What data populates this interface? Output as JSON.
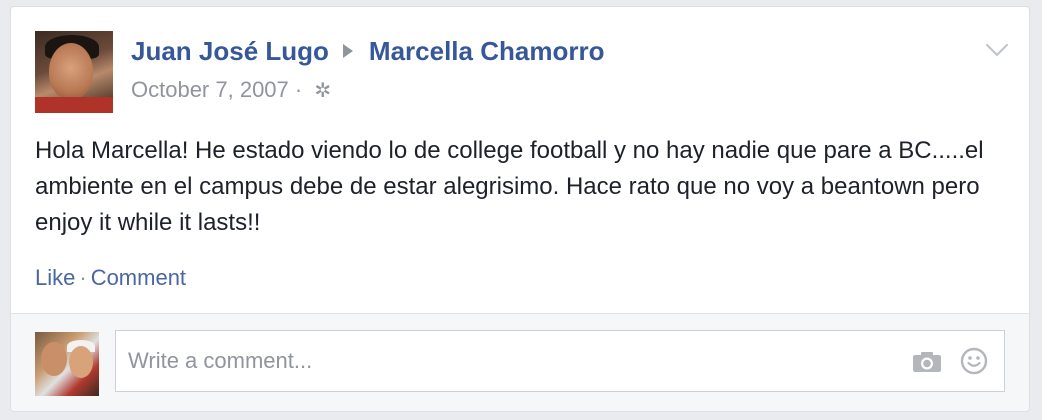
{
  "post": {
    "author": "Juan José Lugo",
    "recipient": "Marcella Chamorro",
    "date": "October 7, 2007",
    "date_separator": "·",
    "privacy_icon": "gear-icon",
    "text": "Hola Marcella! He estado viendo lo de college football y no hay nadie que pare a BC.....el ambiente en el campus debe de estar alegrisimo. Hace rato que no voy a beantown pero enjoy it while it lasts!!",
    "options_icon": "chevron-down-icon"
  },
  "actions": {
    "like_label": "Like",
    "separator": "·",
    "comment_label": "Comment"
  },
  "comment": {
    "placeholder": "Write a comment...",
    "camera_icon": "camera-icon",
    "emoji_icon": "smiley-icon"
  },
  "colors": {
    "link": "#365899",
    "action_link": "#4b67a1",
    "muted": "#90949c",
    "text": "#1d2129",
    "background": "#e9ebee"
  }
}
